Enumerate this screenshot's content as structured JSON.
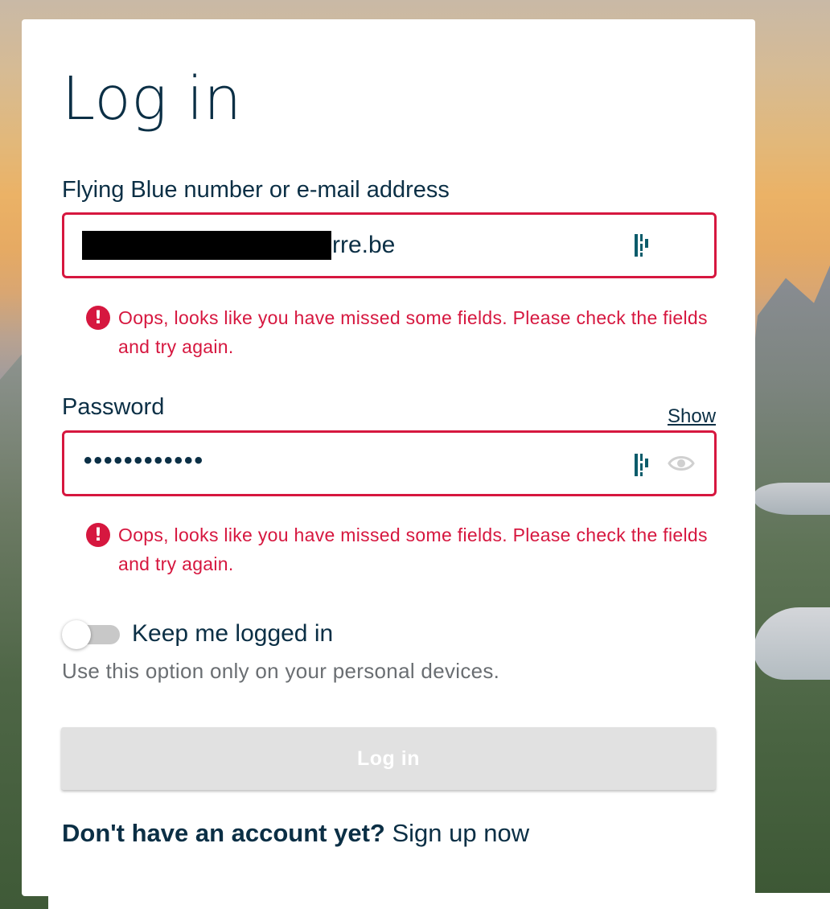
{
  "page": {
    "title": "Log in"
  },
  "email_field": {
    "label": "Flying Blue number or e-mail address",
    "visible_value_suffix": "rre.be",
    "error": "Oops, looks like you have missed some fields. Please check the fields and try again."
  },
  "password_field": {
    "label": "Password",
    "show_label": "Show",
    "masked_value": "••••••••••••",
    "error": "Oops, looks like you have missed some fields. Please check the fields and try again."
  },
  "keep_logged_in": {
    "label": "Keep me logged in",
    "help": "Use this option only on your personal devices.",
    "checked": false
  },
  "login_button": {
    "label": "Log in",
    "disabled": true
  },
  "signup": {
    "prompt": "Don't have an account yet?",
    "link": "Sign up now"
  },
  "colors": {
    "primary_text": "#0b2f45",
    "error": "#d6173f",
    "disabled_button": "#e1e1e1",
    "icon_accent": "#0b5c6b"
  },
  "icons": {
    "field_autofill": "password-manager-icon",
    "password_reveal": "eye-icon",
    "error": "exclamation-circle-icon"
  }
}
